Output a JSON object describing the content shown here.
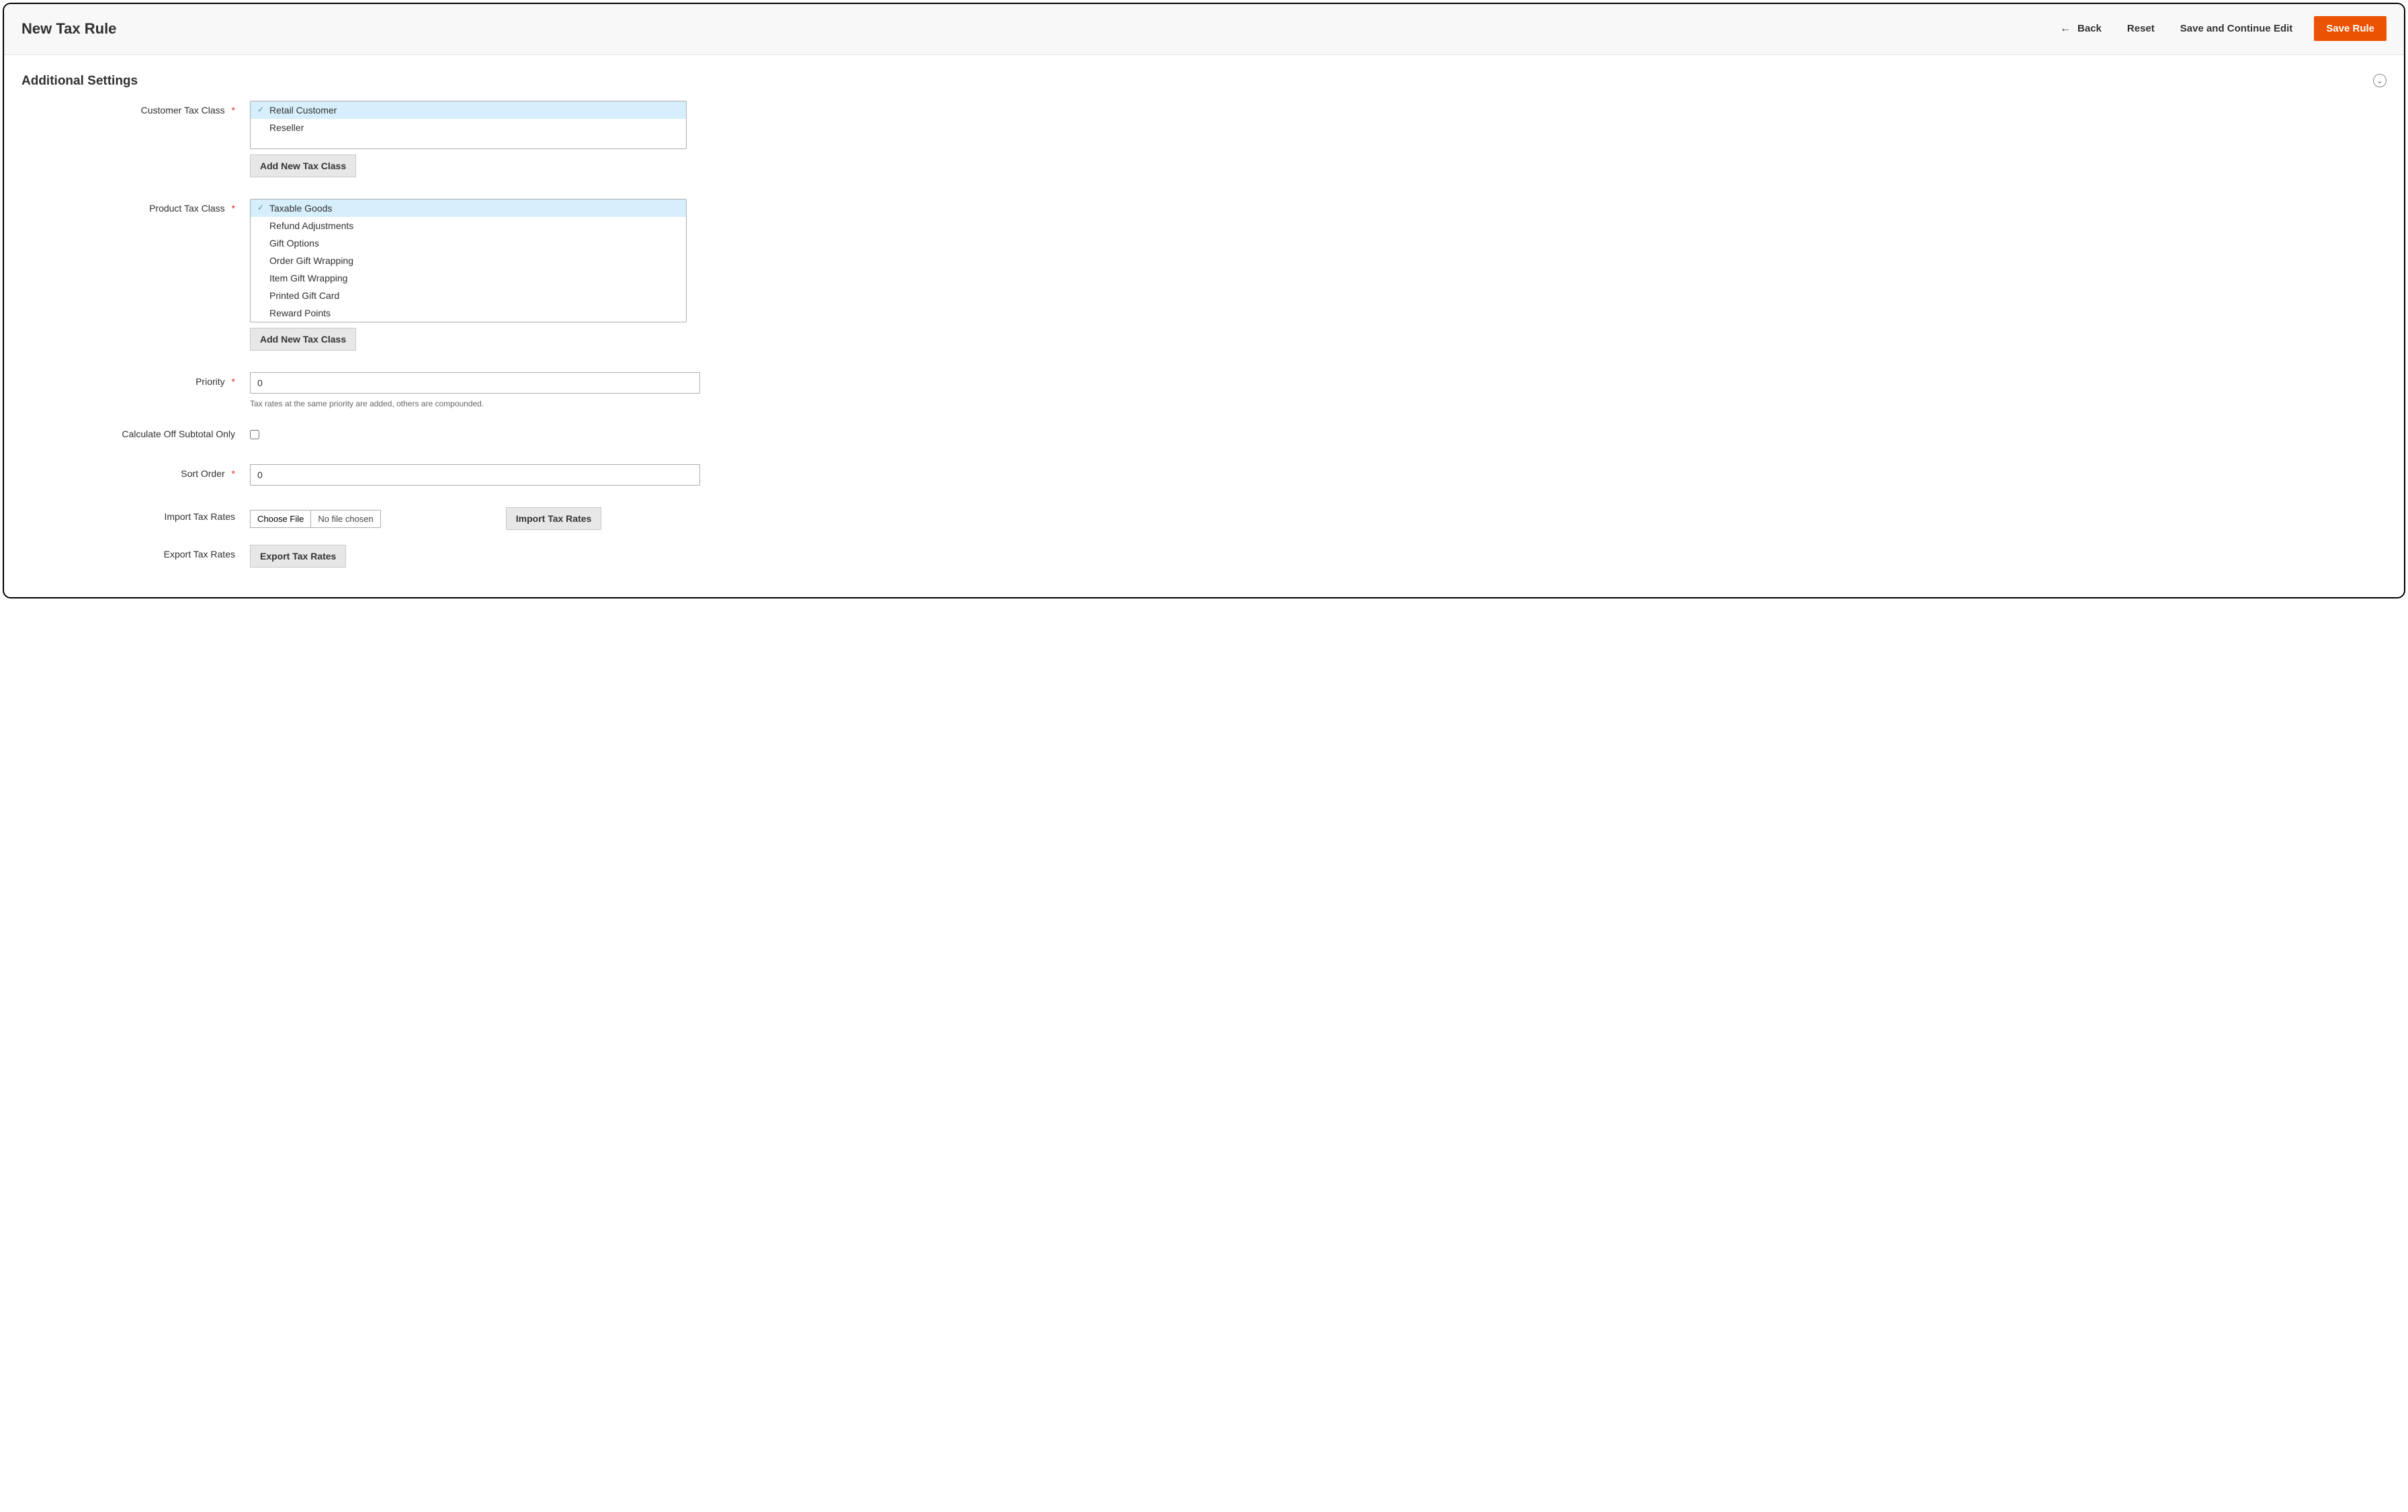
{
  "header": {
    "title": "New Tax Rule",
    "back_label": "Back",
    "reset_label": "Reset",
    "save_continue_label": "Save and Continue Edit",
    "save_label": "Save Rule"
  },
  "section": {
    "title": "Additional Settings"
  },
  "fields": {
    "customer_tax_class": {
      "label": "Customer Tax Class",
      "options": [
        "Retail Customer",
        "Reseller"
      ],
      "selected": [
        0
      ],
      "add_button": "Add New Tax Class"
    },
    "product_tax_class": {
      "label": "Product Tax Class",
      "options": [
        "Taxable Goods",
        "Refund Adjustments",
        "Gift Options",
        "Order Gift Wrapping",
        "Item Gift Wrapping",
        "Printed Gift Card",
        "Reward Points"
      ],
      "selected": [
        0
      ],
      "add_button": "Add New Tax Class"
    },
    "priority": {
      "label": "Priority",
      "value": "0",
      "hint": "Tax rates at the same priority are added, others are compounded."
    },
    "calc_off_subtotal": {
      "label": "Calculate Off Subtotal Only",
      "checked": false
    },
    "sort_order": {
      "label": "Sort Order",
      "value": "0"
    },
    "import_rates": {
      "label": "Import Tax Rates",
      "choose_file_label": "Choose File",
      "no_file_text": "No file chosen",
      "button_label": "Import Tax Rates"
    },
    "export_rates": {
      "label": "Export Tax Rates",
      "button_label": "Export Tax Rates"
    }
  }
}
